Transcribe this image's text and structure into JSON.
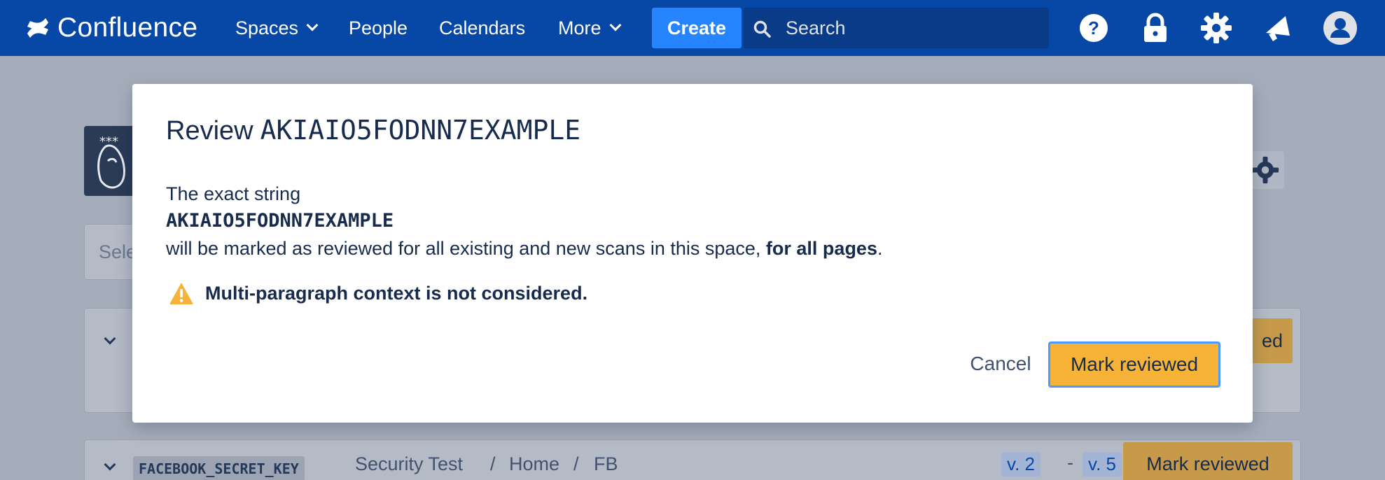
{
  "nav": {
    "logo_text": "Confluence",
    "items": [
      "Spaces",
      "People",
      "Calendars",
      "More"
    ],
    "create_label": "Create",
    "search_placeholder": "Search"
  },
  "page_bg": {
    "select_partial": "Sele",
    "row_label": "FACEBOOK_SECRET_KEY",
    "breadcrumb": [
      "Security Test",
      "/",
      "Home",
      "/",
      "FB"
    ],
    "version_from": "v. 2",
    "version_sep": "-",
    "version_to": "v. 5",
    "mark_reviewed_label": "Mark reviewed",
    "partial_button_label": "ed"
  },
  "modal": {
    "title_prefix": "Review",
    "title_key": "AKIAIO5FODNN7EXAMPLE",
    "line1": "The exact string",
    "line2": "AKIAIO5FODNN7EXAMPLE",
    "line3_pre": "will be marked as reviewed for all existing and new scans in this space, ",
    "line3_bold": "for all pages",
    "line3_post": ".",
    "warning": "Multi-paragraph context is not considered.",
    "cancel_label": "Cancel",
    "confirm_label": "Mark reviewed"
  },
  "colors": {
    "nav_bg": "#0747a6",
    "create_bg": "#2684ff",
    "confirm_bg": "#f6b337",
    "warning": "#f6b337"
  }
}
